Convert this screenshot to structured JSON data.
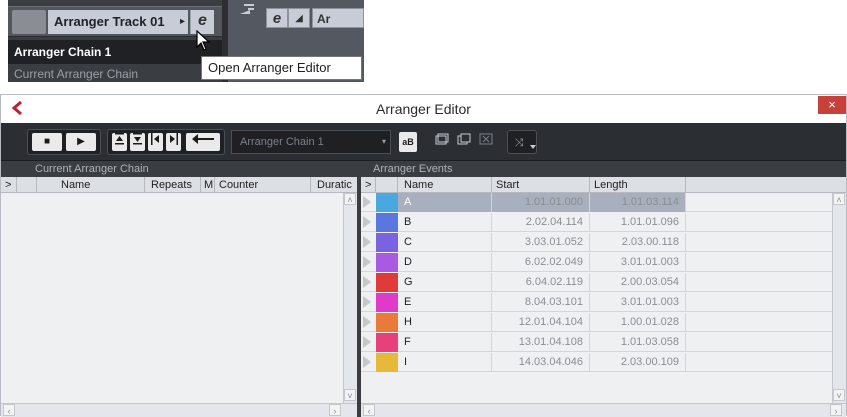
{
  "inset": {
    "track_name": "Arranger Track 01",
    "track_expand_arrow": "▸",
    "edit_glyph": "e",
    "chain_name": "Arranger Chain 1",
    "current_chain_label": "Current Arranger Chain",
    "ruler_btn_edit": "e",
    "ruler_btn_flag": "◢",
    "ruler_btn_partial": "Ar",
    "tooltip": "Open Arranger Editor"
  },
  "window": {
    "title": "Arranger Editor",
    "close_glyph": "×",
    "app_icon": "cubase-icon"
  },
  "toolbar": {
    "stop_glyph": "■",
    "play_glyph": "▶",
    "nav_first_glyph": "⏶",
    "nav_prev_glyph": "⏷",
    "nav_next_glyph": "⏴",
    "nav_last_glyph": "⏵",
    "back_glyph": "↩",
    "chain_select_value": "Arranger Chain 1",
    "chain_select_arrow": "▾",
    "chain_btn_glyph": "aB",
    "chain_new_glyph": "□",
    "chain_dup_glyph": "⧉",
    "chain_del_glyph": "⊠",
    "flatten_glyph": "⤨"
  },
  "left_pane": {
    "title": "Current Arranger Chain",
    "columns": [
      "Name",
      "Repeats",
      "M",
      "Counter",
      "Duratic"
    ],
    "expand_glyph": ">"
  },
  "right_pane": {
    "title": "Arranger Events",
    "columns": [
      "Name",
      "Start",
      "Length"
    ],
    "expand_glyph": ">",
    "events": [
      {
        "name": "A",
        "start": "1.01.01.000",
        "length": "1.01.03.114",
        "color": "#4aa8e0",
        "selected": true
      },
      {
        "name": "B",
        "start": "2.02.04.114",
        "length": "1.01.01.096",
        "color": "#5c76e0",
        "selected": false
      },
      {
        "name": "C",
        "start": "3.03.01.052",
        "length": "2.03.00.118",
        "color": "#7a62e0",
        "selected": false
      },
      {
        "name": "D",
        "start": "6.02.02.049",
        "length": "3.01.01.003",
        "color": "#a85ae0",
        "selected": false
      },
      {
        "name": "G",
        "start": "6.04.02.119",
        "length": "2.00.03.054",
        "color": "#e03a3a",
        "selected": false
      },
      {
        "name": "E",
        "start": "8.04.03.101",
        "length": "3.01.01.003",
        "color": "#e03ac8",
        "selected": false
      },
      {
        "name": "H",
        "start": "12.01.04.104",
        "length": "1.00.01.028",
        "color": "#e87a3a",
        "selected": false
      },
      {
        "name": "F",
        "start": "13.01.04.108",
        "length": "1.01.03.058",
        "color": "#e8407a",
        "selected": false
      },
      {
        "name": "I",
        "start": "14.03.04.046",
        "length": "2.03.00.109",
        "color": "#e8b83a",
        "selected": false
      }
    ]
  },
  "scroll": {
    "up": "˄",
    "down": "˅",
    "left": "‹",
    "right": "›"
  }
}
